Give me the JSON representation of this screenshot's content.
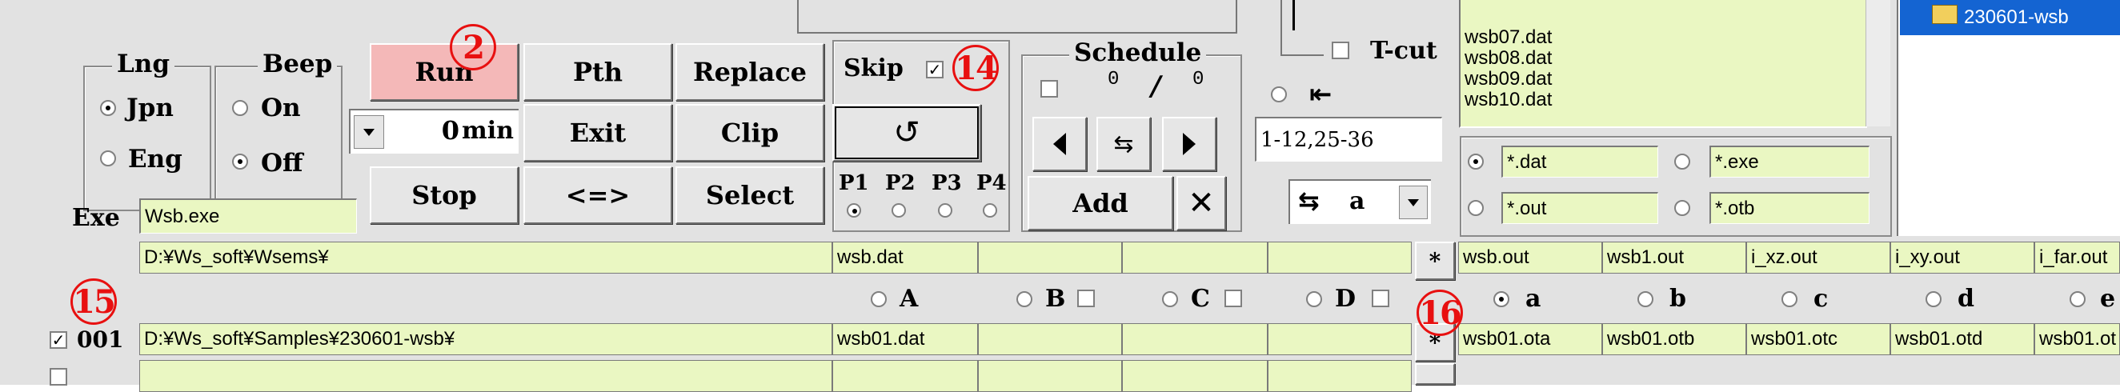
{
  "lng": {
    "title": "Lng",
    "jpn": "Jpn",
    "eng": "Eng",
    "selected": "Jpn"
  },
  "beep": {
    "title": "Beep",
    "on": "On",
    "off": "Off",
    "selected": "Off"
  },
  "buttons": {
    "run": "Run",
    "pth": "Pth",
    "replace": "Replace",
    "exit": "Exit",
    "clip": "Clip",
    "stop": "Stop",
    "swap": "<=>",
    "select": "Select",
    "add": "Add"
  },
  "min_spinner": {
    "value": "0",
    "unit": "min"
  },
  "exe": {
    "label": "Exe",
    "value": "Wsb.exe"
  },
  "skip": {
    "label": "Skip",
    "checked": true
  },
  "pgroups": {
    "labels": [
      "P1",
      "P2",
      "P3",
      "P4"
    ],
    "selected": "P1"
  },
  "schedule": {
    "title": "Schedule",
    "current": "0",
    "sep": "/",
    "total": "0"
  },
  "tcut": {
    "label": "T-cut"
  },
  "range_input": "1-12,25-36",
  "sort_select": "a",
  "file_list": [
    "wsb07.dat",
    "wsb08.dat",
    "wsb09.dat",
    "wsb10.dat"
  ],
  "folder_item": "230601-wsb",
  "filters": {
    "dat": "*.dat",
    "exe": "*.exe",
    "out": "*.out",
    "otb": "*.otb",
    "selected": "*.dat"
  },
  "path_row": {
    "path": "D:¥Ws_soft¥Wsems¥",
    "input_file": "wsb.dat",
    "marker": "*",
    "outputs": [
      "wsb.out",
      "wsb1.out",
      "i_xz.out",
      "i_xy.out",
      "i_far.out"
    ]
  },
  "input_cols": [
    "A",
    "B",
    "C",
    "D"
  ],
  "output_cols": [
    "a",
    "b",
    "c",
    "d",
    "e"
  ],
  "output_selected": "a",
  "row_001": {
    "checked": true,
    "num": "001",
    "path": "D:¥Ws_soft¥Samples¥230601-wsb¥",
    "input_file": "wsb01.dat",
    "marker": "*",
    "outputs": [
      "wsb01.ota",
      "wsb01.otb",
      "wsb01.otc",
      "wsb01.otd",
      "wsb01.ot"
    ]
  },
  "annotations": {
    "run": "2",
    "skip": "14",
    "rows": "15",
    "outputs": "16"
  },
  "colors": {
    "field": "#eaf7c2",
    "run": "#f4b8b8",
    "badge": "#e81010",
    "folder_sel": "#1464d2"
  }
}
